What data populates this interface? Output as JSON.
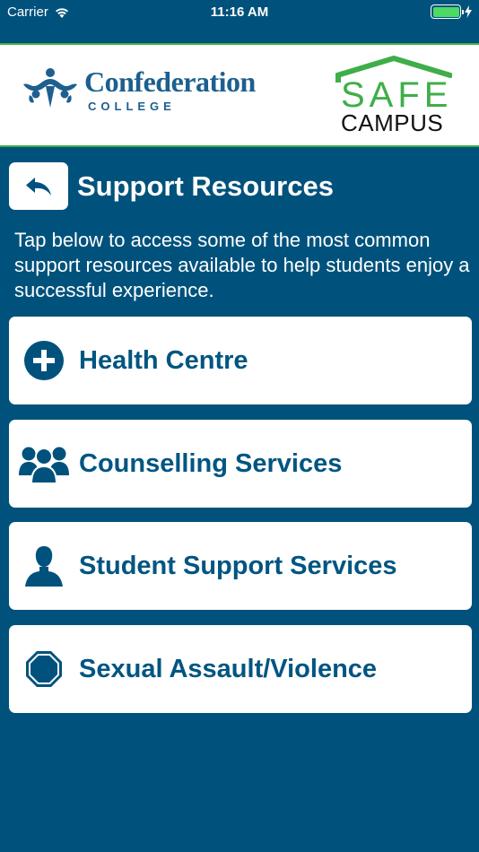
{
  "status_bar": {
    "carrier": "Carrier",
    "time": "11:16 AM",
    "battery_level": 1.0
  },
  "header": {
    "college_name": "Confederation",
    "college_sub": "COLLEGE",
    "safe_top": "SAFE",
    "safe_bottom": "CAMPUS"
  },
  "page": {
    "title": "Support Resources",
    "intro": "Tap below to access some of the most common support resources available to help students enjoy a successful experience."
  },
  "resources": [
    {
      "label": "Health Centre",
      "icon": "plus-circle-icon"
    },
    {
      "label": "Counselling Services",
      "icon": "group-icon"
    },
    {
      "label": "Student Support Services",
      "icon": "person-icon"
    },
    {
      "label": "Sexual Assault/Violence",
      "icon": "stop-sign-icon"
    }
  ],
  "colors": {
    "background": "#00527c",
    "accent_green": "#3fae49",
    "text_blue": "#005581",
    "battery_green": "#4cd964"
  }
}
